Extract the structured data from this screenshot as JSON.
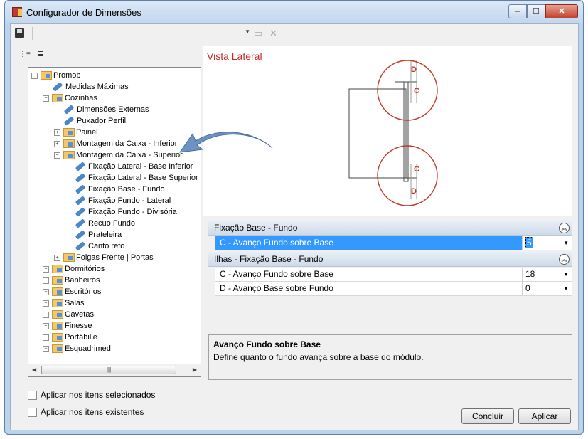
{
  "window": {
    "title": "Configurador de Dimensões",
    "controls": {
      "minimize": "–",
      "maximize": "☐",
      "close": "✕"
    }
  },
  "tree": {
    "nodes": [
      {
        "label": "Promob",
        "depth": 0,
        "type": "folder",
        "expander": "−"
      },
      {
        "label": "Medidas Máximas",
        "depth": 1,
        "type": "item"
      },
      {
        "label": "Cozinhas",
        "depth": 1,
        "type": "folder",
        "expander": "−"
      },
      {
        "label": "Dimensões Externas",
        "depth": 2,
        "type": "item"
      },
      {
        "label": "Puxador Perfil",
        "depth": 2,
        "type": "item"
      },
      {
        "label": "Painel",
        "depth": 2,
        "type": "folder",
        "expander": "+"
      },
      {
        "label": "Montagem da Caixa - Inferior",
        "depth": 2,
        "type": "folder",
        "expander": "+"
      },
      {
        "label": "Montagem da Caixa - Superior",
        "depth": 2,
        "type": "folder",
        "expander": "−"
      },
      {
        "label": "Fixação Lateral - Base Inferior",
        "depth": 3,
        "type": "item"
      },
      {
        "label": "Fixação Lateral - Base Superior",
        "depth": 3,
        "type": "item"
      },
      {
        "label": "Fixação Base - Fundo",
        "depth": 3,
        "type": "item"
      },
      {
        "label": "Fixação Fundo - Lateral",
        "depth": 3,
        "type": "item"
      },
      {
        "label": "Fixação Fundo - Divisória",
        "depth": 3,
        "type": "item"
      },
      {
        "label": "Recuo Fundo",
        "depth": 3,
        "type": "item"
      },
      {
        "label": "Prateleira",
        "depth": 3,
        "type": "item"
      },
      {
        "label": "Canto reto",
        "depth": 3,
        "type": "item"
      },
      {
        "label": "Folgas Frente | Portas",
        "depth": 2,
        "type": "folder",
        "expander": "+"
      },
      {
        "label": "Dormitórios",
        "depth": 1,
        "type": "folder",
        "expander": "+"
      },
      {
        "label": "Banheiros",
        "depth": 1,
        "type": "folder",
        "expander": "+"
      },
      {
        "label": "Escritórios",
        "depth": 1,
        "type": "folder",
        "expander": "+"
      },
      {
        "label": "Salas",
        "depth": 1,
        "type": "folder",
        "expander": "+"
      },
      {
        "label": "Gavetas",
        "depth": 1,
        "type": "folder",
        "expander": "+"
      },
      {
        "label": "Finesse",
        "depth": 1,
        "type": "folder",
        "expander": "+"
      },
      {
        "label": "Portábille",
        "depth": 1,
        "type": "folder",
        "expander": "+"
      },
      {
        "label": "Esquadrimed",
        "depth": 1,
        "type": "folder",
        "expander": "+"
      }
    ]
  },
  "checkboxes": {
    "selected_items": "Aplicar nos itens selecionados",
    "existing_items": "Aplicar nos itens existentes"
  },
  "preview": {
    "title": "Vista Lateral",
    "label_d": "D",
    "label_c": "C"
  },
  "properties": {
    "category1": {
      "title": "Fixação Base - Fundo",
      "rows": [
        {
          "name": "C - Avanço Fundo sobre Base",
          "value": "5"
        }
      ]
    },
    "category2": {
      "title": "Ilhas - Fixação Base - Fundo",
      "rows": [
        {
          "name": "C - Avanço Fundo sobre Base",
          "value": "18"
        },
        {
          "name": "D - Avanço Base sobre Fundo",
          "value": "0"
        }
      ]
    }
  },
  "description": {
    "title": "Avanço Fundo sobre Base",
    "text": "Define quanto o fundo avança sobre a base do módulo."
  },
  "buttons": {
    "concluir": "Concluir",
    "aplicar": "Aplicar"
  },
  "colors": {
    "accent": "#3399ff",
    "drawing_red": "#c0392b",
    "arrow_blue": "#6d93c4"
  }
}
